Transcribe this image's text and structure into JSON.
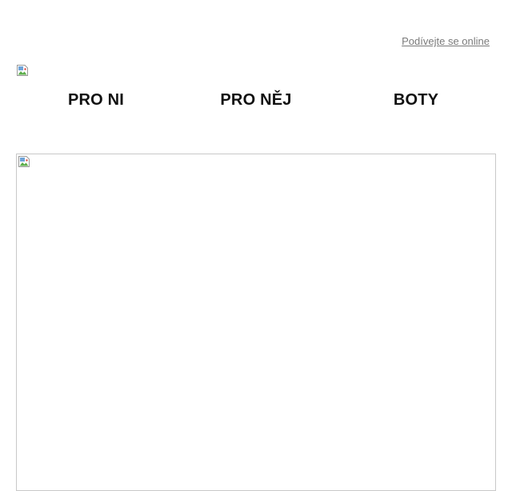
{
  "header": {
    "view_online_label": "Podívejte se online"
  },
  "nav": {
    "items": [
      {
        "label": "PRO NI"
      },
      {
        "label": "PRO NĚJ"
      },
      {
        "label": "BOTY"
      }
    ]
  },
  "icons": {
    "logo": "broken-image-icon",
    "hero": "broken-image-icon"
  },
  "colors": {
    "link": "#7a7a7a",
    "nav_text": "#111111",
    "hero_border": "#c8c8c8"
  }
}
